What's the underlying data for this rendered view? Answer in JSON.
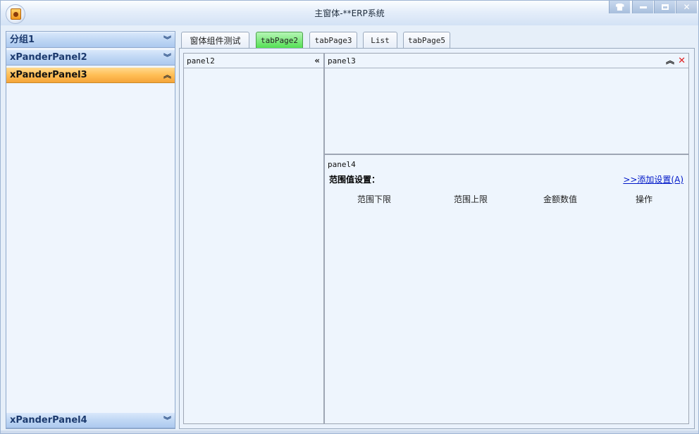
{
  "window": {
    "title": "主窗体-**ERP系统",
    "controls": [
      "skin-icon",
      "minimize-icon",
      "maximize-icon",
      "close-icon"
    ]
  },
  "accordion": {
    "items": [
      {
        "label": "分组1",
        "expanded": false
      },
      {
        "label": "xPanderPanel2",
        "expanded": false
      },
      {
        "label": "xPanderPanel3",
        "expanded": true
      },
      {
        "label": "xPanderPanel4",
        "expanded": false
      }
    ]
  },
  "tabs": {
    "items": [
      {
        "label": "窗体组件测试",
        "selected": false
      },
      {
        "label": "tabPage2",
        "selected": true
      },
      {
        "label": "tabPage3",
        "selected": false
      },
      {
        "label": "List",
        "selected": false
      },
      {
        "label": "tabPage5",
        "selected": false
      }
    ],
    "selected_color": "#4fe04f"
  },
  "panels": {
    "panel2": {
      "title": "panel2"
    },
    "panel3": {
      "title": "panel3"
    },
    "panel4": {
      "title": "panel4",
      "range_title": "范围值设置：",
      "add_link": ">>添加设置(A)",
      "columns": [
        "范围下限",
        "范围上限",
        "金额数值",
        "操作"
      ]
    }
  },
  "colors": {
    "active_accordion": "#ffbe55",
    "link": "#0018c8",
    "close": "#e02020"
  }
}
